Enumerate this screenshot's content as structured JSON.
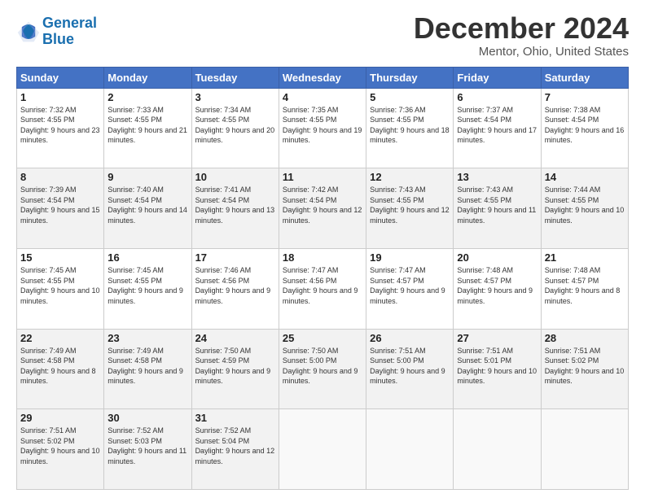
{
  "header": {
    "logo_line1": "General",
    "logo_line2": "Blue",
    "month": "December 2024",
    "location": "Mentor, Ohio, United States"
  },
  "weekdays": [
    "Sunday",
    "Monday",
    "Tuesday",
    "Wednesday",
    "Thursday",
    "Friday",
    "Saturday"
  ],
  "weeks": [
    [
      {
        "day": "1",
        "sunrise": "7:32 AM",
        "sunset": "4:55 PM",
        "daylight": "9 hours and 23 minutes."
      },
      {
        "day": "2",
        "sunrise": "7:33 AM",
        "sunset": "4:55 PM",
        "daylight": "9 hours and 21 minutes."
      },
      {
        "day": "3",
        "sunrise": "7:34 AM",
        "sunset": "4:55 PM",
        "daylight": "9 hours and 20 minutes."
      },
      {
        "day": "4",
        "sunrise": "7:35 AM",
        "sunset": "4:55 PM",
        "daylight": "9 hours and 19 minutes."
      },
      {
        "day": "5",
        "sunrise": "7:36 AM",
        "sunset": "4:55 PM",
        "daylight": "9 hours and 18 minutes."
      },
      {
        "day": "6",
        "sunrise": "7:37 AM",
        "sunset": "4:54 PM",
        "daylight": "9 hours and 17 minutes."
      },
      {
        "day": "7",
        "sunrise": "7:38 AM",
        "sunset": "4:54 PM",
        "daylight": "9 hours and 16 minutes."
      }
    ],
    [
      {
        "day": "8",
        "sunrise": "7:39 AM",
        "sunset": "4:54 PM",
        "daylight": "9 hours and 15 minutes."
      },
      {
        "day": "9",
        "sunrise": "7:40 AM",
        "sunset": "4:54 PM",
        "daylight": "9 hours and 14 minutes."
      },
      {
        "day": "10",
        "sunrise": "7:41 AM",
        "sunset": "4:54 PM",
        "daylight": "9 hours and 13 minutes."
      },
      {
        "day": "11",
        "sunrise": "7:42 AM",
        "sunset": "4:54 PM",
        "daylight": "9 hours and 12 minutes."
      },
      {
        "day": "12",
        "sunrise": "7:43 AM",
        "sunset": "4:55 PM",
        "daylight": "9 hours and 12 minutes."
      },
      {
        "day": "13",
        "sunrise": "7:43 AM",
        "sunset": "4:55 PM",
        "daylight": "9 hours and 11 minutes."
      },
      {
        "day": "14",
        "sunrise": "7:44 AM",
        "sunset": "4:55 PM",
        "daylight": "9 hours and 10 minutes."
      }
    ],
    [
      {
        "day": "15",
        "sunrise": "7:45 AM",
        "sunset": "4:55 PM",
        "daylight": "9 hours and 10 minutes."
      },
      {
        "day": "16",
        "sunrise": "7:45 AM",
        "sunset": "4:55 PM",
        "daylight": "9 hours and 9 minutes."
      },
      {
        "day": "17",
        "sunrise": "7:46 AM",
        "sunset": "4:56 PM",
        "daylight": "9 hours and 9 minutes."
      },
      {
        "day": "18",
        "sunrise": "7:47 AM",
        "sunset": "4:56 PM",
        "daylight": "9 hours and 9 minutes."
      },
      {
        "day": "19",
        "sunrise": "7:47 AM",
        "sunset": "4:57 PM",
        "daylight": "9 hours and 9 minutes."
      },
      {
        "day": "20",
        "sunrise": "7:48 AM",
        "sunset": "4:57 PM",
        "daylight": "9 hours and 9 minutes."
      },
      {
        "day": "21",
        "sunrise": "7:48 AM",
        "sunset": "4:57 PM",
        "daylight": "9 hours and 8 minutes."
      }
    ],
    [
      {
        "day": "22",
        "sunrise": "7:49 AM",
        "sunset": "4:58 PM",
        "daylight": "9 hours and 8 minutes."
      },
      {
        "day": "23",
        "sunrise": "7:49 AM",
        "sunset": "4:58 PM",
        "daylight": "9 hours and 9 minutes."
      },
      {
        "day": "24",
        "sunrise": "7:50 AM",
        "sunset": "4:59 PM",
        "daylight": "9 hours and 9 minutes."
      },
      {
        "day": "25",
        "sunrise": "7:50 AM",
        "sunset": "5:00 PM",
        "daylight": "9 hours and 9 minutes."
      },
      {
        "day": "26",
        "sunrise": "7:51 AM",
        "sunset": "5:00 PM",
        "daylight": "9 hours and 9 minutes."
      },
      {
        "day": "27",
        "sunrise": "7:51 AM",
        "sunset": "5:01 PM",
        "daylight": "9 hours and 10 minutes."
      },
      {
        "day": "28",
        "sunrise": "7:51 AM",
        "sunset": "5:02 PM",
        "daylight": "9 hours and 10 minutes."
      }
    ],
    [
      {
        "day": "29",
        "sunrise": "7:51 AM",
        "sunset": "5:02 PM",
        "daylight": "9 hours and 10 minutes."
      },
      {
        "day": "30",
        "sunrise": "7:52 AM",
        "sunset": "5:03 PM",
        "daylight": "9 hours and 11 minutes."
      },
      {
        "day": "31",
        "sunrise": "7:52 AM",
        "sunset": "5:04 PM",
        "daylight": "9 hours and 12 minutes."
      },
      null,
      null,
      null,
      null
    ]
  ],
  "labels": {
    "sunrise": "Sunrise:",
    "sunset": "Sunset:",
    "daylight": "Daylight:"
  }
}
